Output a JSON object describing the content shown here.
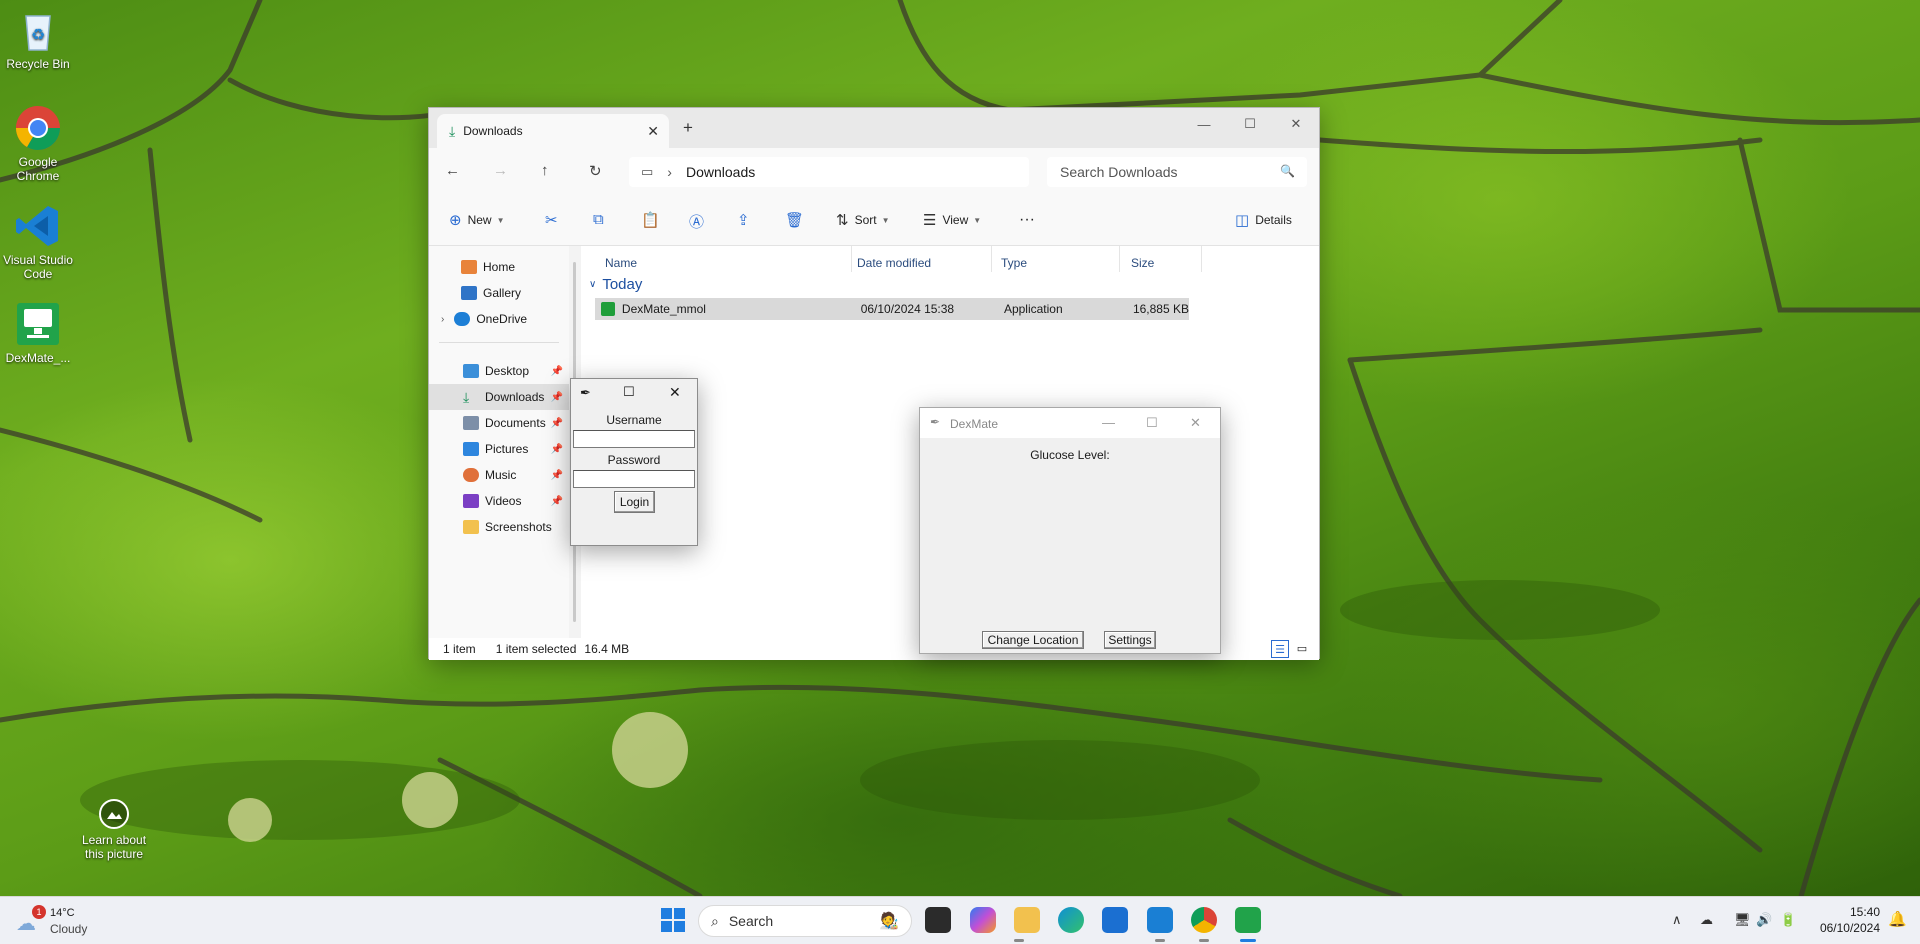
{
  "desktop": {
    "icons": [
      {
        "label": "Recycle Bin"
      },
      {
        "label": "Google Chrome"
      },
      {
        "label": "Visual Studio Code"
      },
      {
        "label": "DexMate_..."
      }
    ],
    "learn": {
      "label": "Learn about this picture"
    }
  },
  "explorer": {
    "tab_title": "Downloads",
    "address": "Downloads",
    "search_placeholder": "Search Downloads",
    "commands": {
      "new": "New",
      "sort": "Sort",
      "view": "View",
      "details": "Details"
    },
    "nav": [
      {
        "label": "Home"
      },
      {
        "label": "Gallery"
      },
      {
        "label": "OneDrive"
      },
      {
        "label": "Desktop"
      },
      {
        "label": "Downloads"
      },
      {
        "label": "Documents"
      },
      {
        "label": "Pictures"
      },
      {
        "label": "Music"
      },
      {
        "label": "Videos"
      },
      {
        "label": "Screenshots"
      }
    ],
    "columns": {
      "name": "Name",
      "date": "Date modified",
      "type": "Type",
      "size": "Size"
    },
    "group": "Today",
    "files": [
      {
        "name": "DexMate_mmol",
        "date": "06/10/2024 15:38",
        "type": "Application",
        "size": "16,885 KB"
      }
    ],
    "status": {
      "count": "1 item",
      "selected": "1 item selected",
      "size": "16.4 MB"
    }
  },
  "login": {
    "username_label": "Username",
    "password_label": "Password",
    "button": "Login"
  },
  "dexmate": {
    "title": "DexMate",
    "glucose_label": "Glucose Level:",
    "change_location": "Change Location",
    "settings": "Settings"
  },
  "taskbar": {
    "weather": {
      "temp": "14°C",
      "condition": "Cloudy",
      "badge": "1"
    },
    "search_label": "Search",
    "time": "15:40",
    "date": "06/10/2024"
  }
}
